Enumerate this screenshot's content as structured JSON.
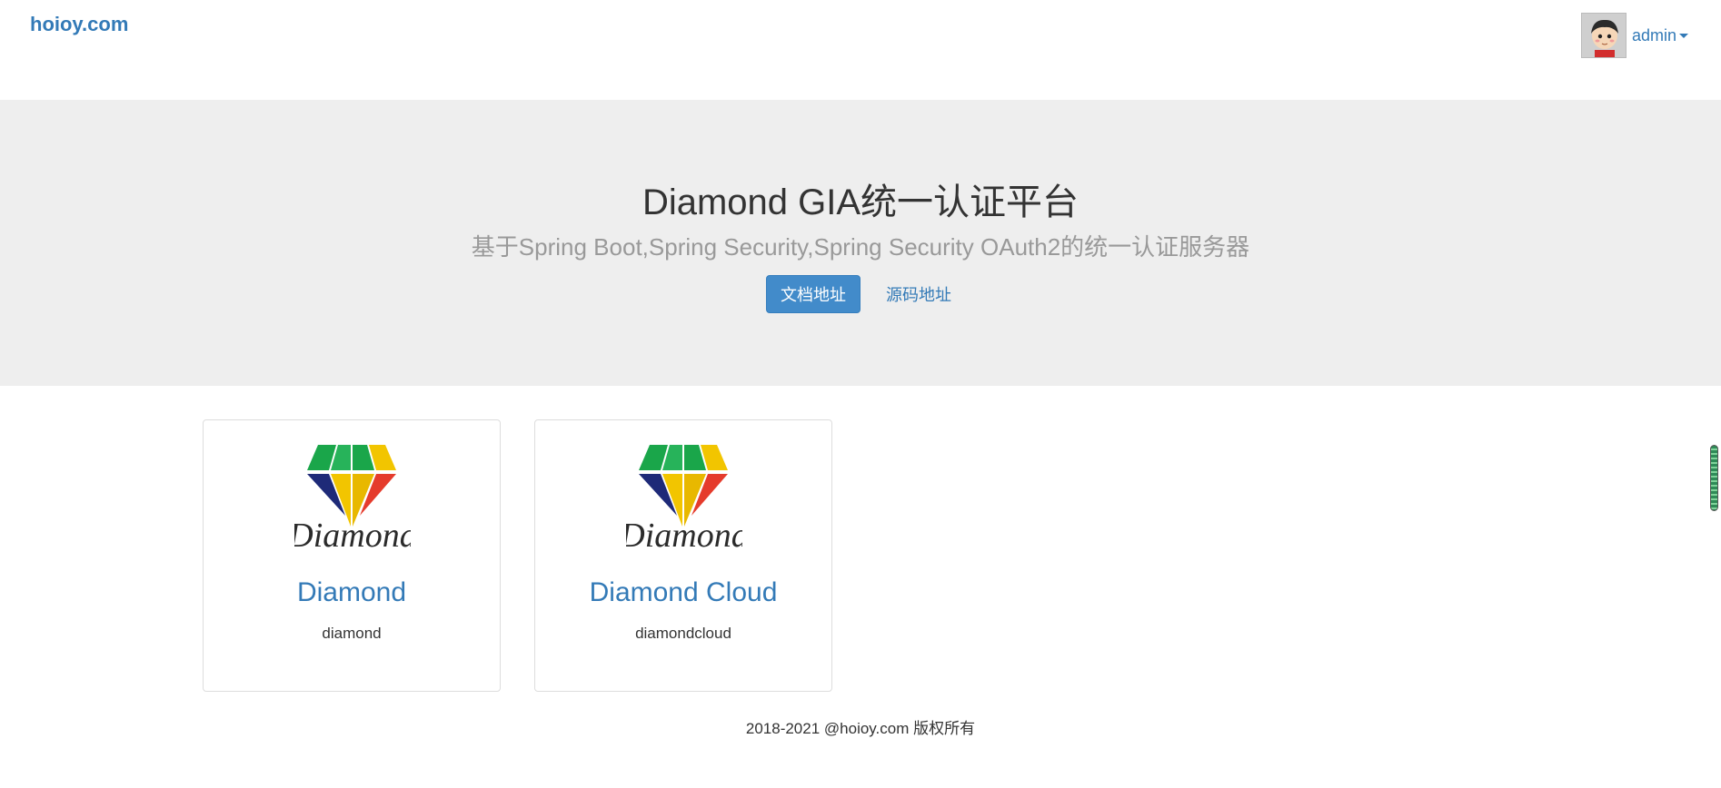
{
  "header": {
    "brand": "hoioy.com",
    "user": {
      "name": "admin",
      "avatar_icon": "cartoon-avatar-icon"
    }
  },
  "hero": {
    "title": "Diamond GIA统一认证平台",
    "subtitle": "基于Spring Boot,Spring Security,Spring Security OAuth2的统一认证服务器",
    "primary_button": "文档地址",
    "link_button": "源码地址"
  },
  "apps": [
    {
      "name": "Diamond",
      "code": "diamond",
      "logo_text": "Diamond"
    },
    {
      "name": "Diamond Cloud",
      "code": "diamondcloud",
      "logo_text": "Diamond"
    }
  ],
  "footer": {
    "text": "2018-2021 @hoioy.com 版权所有"
  },
  "colors": {
    "link": "#337ab7",
    "primary": "#428bca",
    "jumbotron_bg": "#eeeeee",
    "muted": "#999999",
    "diamond_green": "#1aa64a",
    "diamond_yellow": "#f2c500",
    "diamond_red": "#e53b2c",
    "diamond_navy": "#1e2a78"
  }
}
